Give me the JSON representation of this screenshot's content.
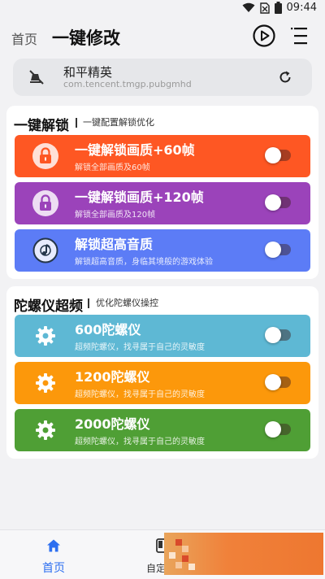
{
  "status_bar": {
    "time": "09:44"
  },
  "header": {
    "home_label": "首页",
    "title": "一键修改"
  },
  "game": {
    "name": "和平精英",
    "package": "com.tencent.tmgp.pubgmhd"
  },
  "sections": [
    {
      "title": "一键解锁",
      "subtitle": "一键配置解锁优化",
      "items": [
        {
          "title": "一键解锁画质+60帧",
          "desc": "解锁全部画质及60帧",
          "color": "#fe5723",
          "icon": "lock-icon",
          "enabled": false
        },
        {
          "title": "一键解锁画质+120帧",
          "desc": "解锁全部画质及120帧",
          "color": "#9b43ba",
          "icon": "lock-icon",
          "enabled": false
        },
        {
          "title": "解锁超高音质",
          "desc": "解锁超高音质，身临其境般的游戏体验",
          "color": "#5c7cf6",
          "icon": "music-note-icon",
          "enabled": false
        }
      ]
    },
    {
      "title": "陀螺仪超频",
      "subtitle": "优化陀螺仪操控",
      "items": [
        {
          "title": "600陀螺仪",
          "desc": "超频陀螺仪，找寻属于自己的灵敏度",
          "color": "#5eb8d4",
          "icon": "gear-icon",
          "enabled": false
        },
        {
          "title": "1200陀螺仪",
          "desc": "超频陀螺仪，找寻属于自己的灵敏度",
          "color": "#fc980b",
          "icon": "gear-icon",
          "enabled": false
        },
        {
          "title": "2000陀螺仪",
          "desc": "超频陀螺仪，找寻属于自己的灵敏度",
          "color": "#4f9f35",
          "icon": "gear-icon",
          "enabled": false
        }
      ]
    }
  ],
  "bottom_nav": {
    "tabs": [
      {
        "label": "首页",
        "active": true,
        "icon": "home-icon"
      },
      {
        "label": "自定",
        "active": false,
        "icon": "phone-icon"
      }
    ]
  }
}
